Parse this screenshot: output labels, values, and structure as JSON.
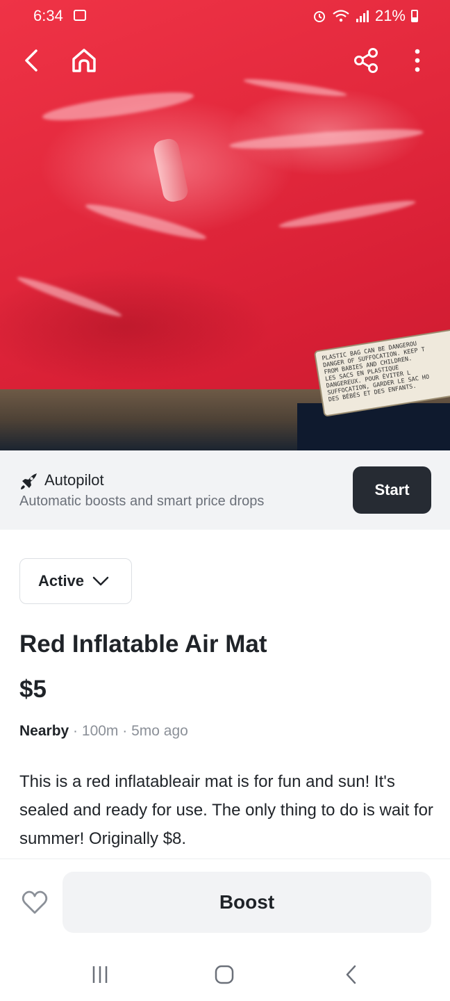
{
  "status_bar": {
    "time": "6:34",
    "battery": "21%"
  },
  "hero": {
    "label_text": "PLASTIC BAG CAN BE DANGEROU\nDANGER OF SUFFOCATION. KEEP T\nFROM BABIES AND CHILDREN.\nLES SACS EN PLASTIQUE\nDANGEREUX. POUR ÉVITER L\nSUFFOCATION, GARDER LE SAC HO\nDES BÉBÉS ET DES ENFANTS."
  },
  "autopilot": {
    "title": "Autopilot",
    "subtitle": "Automatic boosts and smart price drops",
    "start_label": "Start"
  },
  "listing": {
    "status": "Active",
    "title": "Red Inflatable Air Mat",
    "price": "$5",
    "location_label": "Nearby",
    "distance": "100m",
    "age": "5mo ago",
    "separator": "·",
    "description": "This is a red inflatableair mat is  for fun and sun! It's sealed and ready for use. The only thing to do is wait for summer! Originally $8."
  },
  "bottom_bar": {
    "boost_label": "Boost"
  },
  "icons": {
    "back": "back-arrow-icon",
    "home": "home-icon",
    "share": "share-icon",
    "more": "more-vertical-icon",
    "rocket": "rocket-icon",
    "chevron": "chevron-down-icon",
    "heart": "heart-icon"
  },
  "colors": {
    "start_button": "#262b33",
    "autopilot_bg": "#f2f3f5",
    "boost_bg": "#f2f3f5",
    "text_primary": "#1f2328",
    "text_secondary": "#8b9098"
  }
}
